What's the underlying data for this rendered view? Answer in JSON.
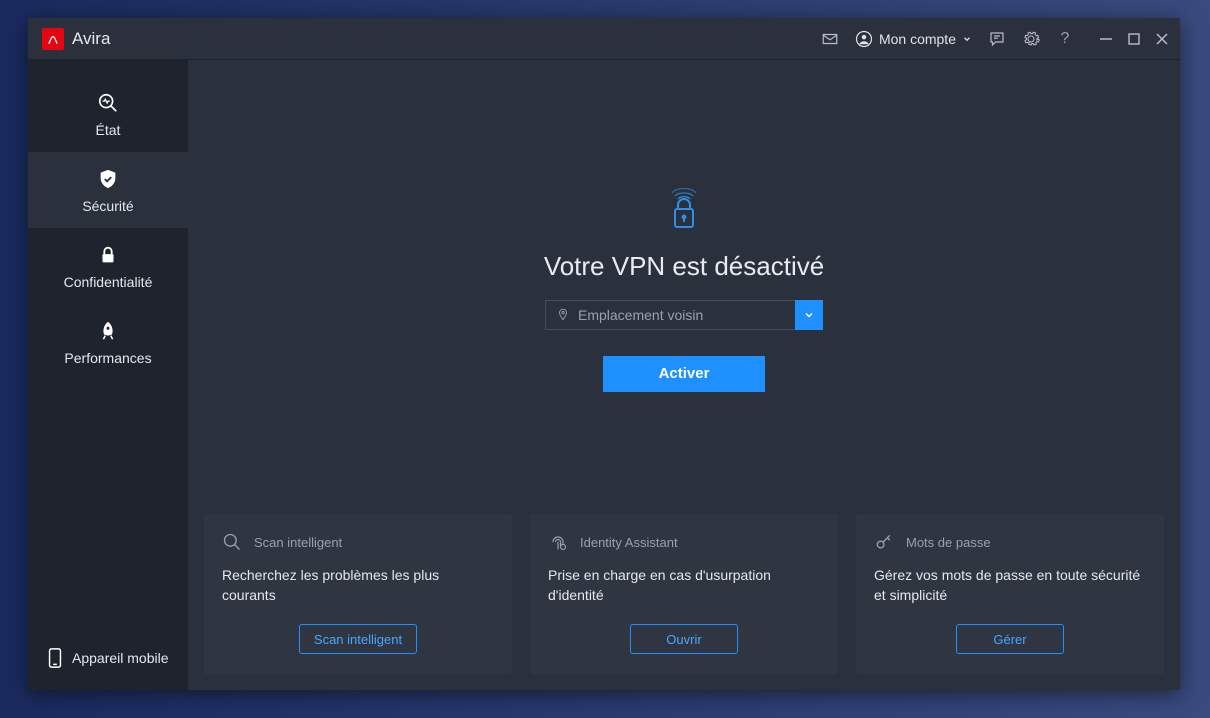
{
  "app": {
    "name": "Avira"
  },
  "titlebar": {
    "account_label": "Mon compte"
  },
  "sidebar": {
    "items": [
      {
        "label": "État"
      },
      {
        "label": "Sécurité"
      },
      {
        "label": "Confidentialité"
      },
      {
        "label": "Performances"
      }
    ],
    "mobile_label": "Appareil mobile"
  },
  "vpn": {
    "title": "Votre VPN est désactivé",
    "location_label": "Emplacement voisin",
    "activate_label": "Activer"
  },
  "cards": [
    {
      "title": "Scan intelligent",
      "description": "Recherchez les problèmes les plus courants",
      "button": "Scan intelligent"
    },
    {
      "title": "Identity Assistant",
      "description": "Prise en charge en cas d'usurpation d'identité",
      "button": "Ouvrir"
    },
    {
      "title": "Mots de passe",
      "description": "Gérez vos mots de passe en toute sécurité et simplicité",
      "button": "Gérer"
    }
  ]
}
